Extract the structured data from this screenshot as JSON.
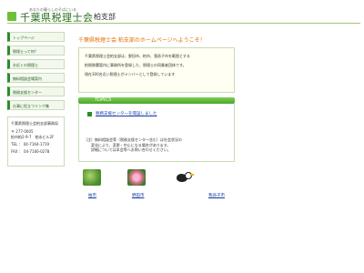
{
  "header": {
    "tagline": "あなたの暮らしのそばにいる",
    "title": "千葉県税理士会",
    "branch": "柏支部"
  },
  "sidebar": {
    "items": [
      {
        "label": "トップページ"
      },
      {
        "label": "税理士って何？"
      },
      {
        "label": "お近くの税理士"
      },
      {
        "label": "無料相談会場案内"
      },
      {
        "label": "税務支援センター"
      },
      {
        "label": "仕事に役立つリンク集"
      }
    ],
    "contact": {
      "org": "千葉県税理士会柏支部事務局",
      "postal": "〒 277-0005",
      "address": "柏市柏2-9-7　柏永ビル2F",
      "tel": "TEL ： 04-7164-1719",
      "fax": "FAX ： 04-7166-0278"
    }
  },
  "main": {
    "welcome": "千葉県税理士会 柏支部のホームページへようこそ！",
    "intro": [
      "千葉県税理士会柏支部は、野田市、柏市、我孫子市を範囲とする",
      "柏税務署管内に事務所を登録した、税理士の同業者団体です。",
      "現在300名近い税理士がメンバーとして登録しています"
    ],
    "topics_label": "TOPICS",
    "topic_link": "税務支援センターを開設しました",
    "notice": [
      "（注）無料相談会等（税務支援センター含む）は社会状況の",
      "　　変化により、変更・中止になる場合があります。",
      "　　詳細については本会等へお問い合わせください。"
    ],
    "photos": [
      {
        "label": "柏市",
        "icon": "leaf-photo"
      },
      {
        "label": "野田市",
        "icon": "flower-photo"
      },
      {
        "label": "我孫子市",
        "icon": "bird-photo"
      }
    ]
  },
  "colors": {
    "accent_green": "#2e8b2e",
    "welcome_orange": "#e07000",
    "link_blue": "#1a3fa8"
  }
}
